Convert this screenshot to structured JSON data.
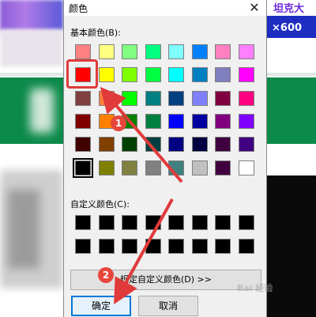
{
  "background": {
    "top_right_text": "坦克大",
    "score_text": "×600"
  },
  "dialog": {
    "title": "颜色",
    "close_glyph": "✕",
    "basic_colors_label": "基本颜色(B):",
    "custom_colors_label": "自定义颜色(C):",
    "define_custom_button": "规定自定义颜色(D) >>",
    "ok_button": "确定",
    "cancel_button": "取消"
  },
  "basic_colors": [
    [
      "#ff8080",
      "#ffff80",
      "#80ff80",
      "#00ff80",
      "#80ffff",
      "#0080ff",
      "#ff80c0",
      "#ff80ff"
    ],
    [
      "#ff0000",
      "#ffff00",
      "#80ff00",
      "#00ff40",
      "#00ffff",
      "#0080c0",
      "#8080c0",
      "#ff00ff"
    ],
    [
      "#804040",
      "#ff8040",
      "#00ff00",
      "#008080",
      "#004080",
      "#8080ff",
      "#800040",
      "#ff0080"
    ],
    [
      "#800000",
      "#ff8000",
      "#008000",
      "#008040",
      "#0000ff",
      "#0000a0",
      "#800080",
      "#8000ff"
    ],
    [
      "#400000",
      "#804000",
      "#004000",
      "#004040",
      "#000080",
      "#000040",
      "#400040",
      "#400080"
    ],
    [
      "#000000",
      "#808000",
      "#808040",
      "#808080",
      "#408080",
      "#c0c0c0",
      "#400040",
      "#ffffff"
    ]
  ],
  "selected_basic_color": "#ff0000",
  "custom_colors": [
    [
      "#000000",
      "#000000",
      "#000000",
      "#000000",
      "#000000",
      "#000000",
      "#000000",
      "#000000"
    ],
    [
      "#000000",
      "#000000",
      "#000000",
      "#000000",
      "#000000",
      "#000000",
      "#000000",
      "#000000"
    ]
  ],
  "annotations": {
    "step1": "1",
    "step2": "2",
    "accent_color": "#e03a3a"
  },
  "watermark": "Bai 经验"
}
